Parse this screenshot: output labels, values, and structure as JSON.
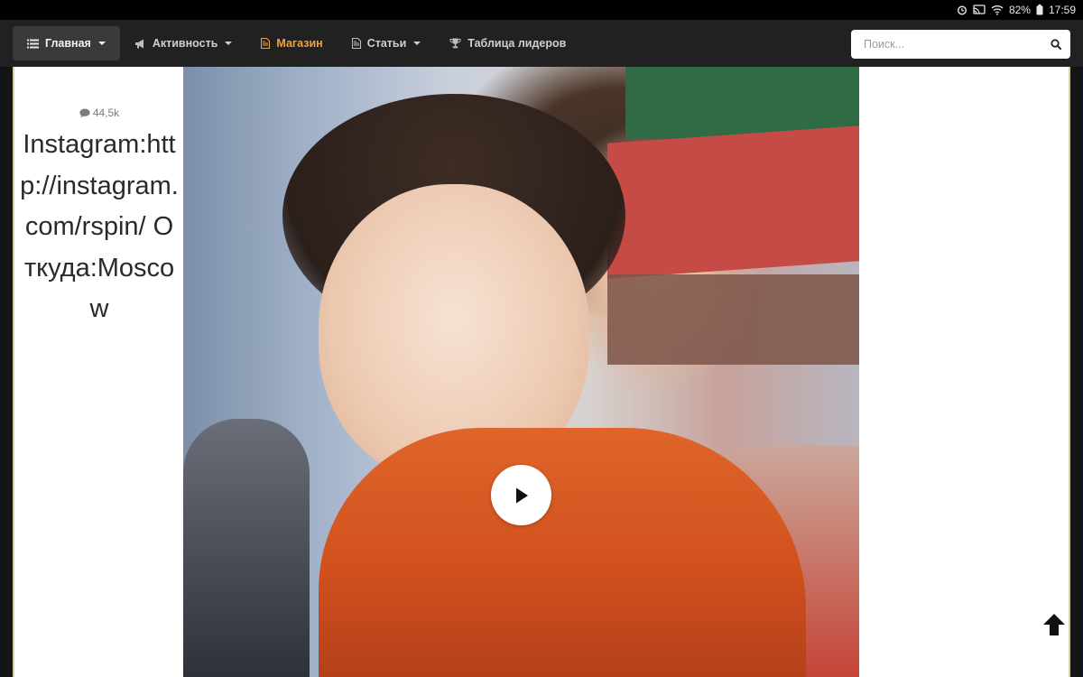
{
  "status_bar": {
    "battery": "82%",
    "time": "17:59"
  },
  "nav": {
    "items": [
      {
        "label": "Главная",
        "icon": "list-icon",
        "dropdown": true
      },
      {
        "label": "Активность",
        "icon": "megaphone-icon",
        "dropdown": true
      },
      {
        "label": "Магазин",
        "icon": "document-icon",
        "dropdown": false
      },
      {
        "label": "Статьи",
        "icon": "document-icon",
        "dropdown": true
      },
      {
        "label": "Таблица лидеров",
        "icon": "trophy-icon",
        "dropdown": false
      }
    ],
    "active_color": "#3a3a3a",
    "shop_color": "#f0a23b"
  },
  "search": {
    "placeholder": "Поиск..."
  },
  "sidebar": {
    "comment_count": "44,5k",
    "bio": "Instagram:http://instagram.com/rspin/ Откуда:Moscow"
  },
  "video": {
    "play_icon": "play-icon"
  },
  "scroll_top": {
    "icon": "arrow-up-icon"
  }
}
